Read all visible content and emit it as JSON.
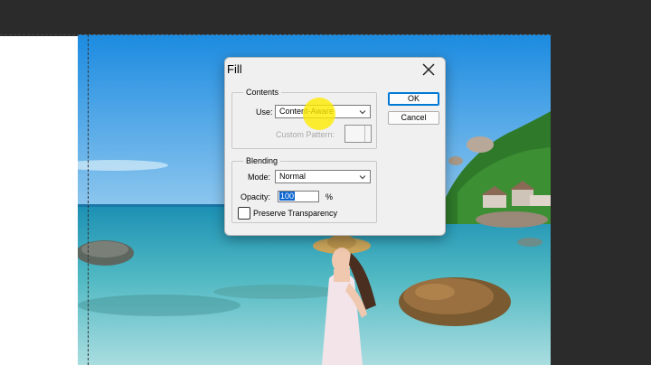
{
  "dialog": {
    "title": "Fill",
    "contents_group_label": "Contents",
    "use_label": "Use:",
    "use_value": "Content-Aware",
    "custom_pattern_label": "Custom Pattern:",
    "blending_group_label": "Blending",
    "mode_label": "Mode:",
    "mode_value": "Normal",
    "opacity_label": "Opacity:",
    "opacity_value": "100",
    "percent": "%",
    "preserve_label": "Preserve Transparency",
    "preserve_checked": false,
    "ok_label": "OK",
    "cancel_label": "Cancel"
  },
  "colors": {
    "accent": "#0078d4",
    "highlight_cursor": "#ffeb00",
    "dialog_bg": "#f0f0f0",
    "workspace_bg": "#2b2b2b"
  },
  "icons": {
    "close": "close-icon",
    "dropdown": "chevron-down-icon"
  }
}
